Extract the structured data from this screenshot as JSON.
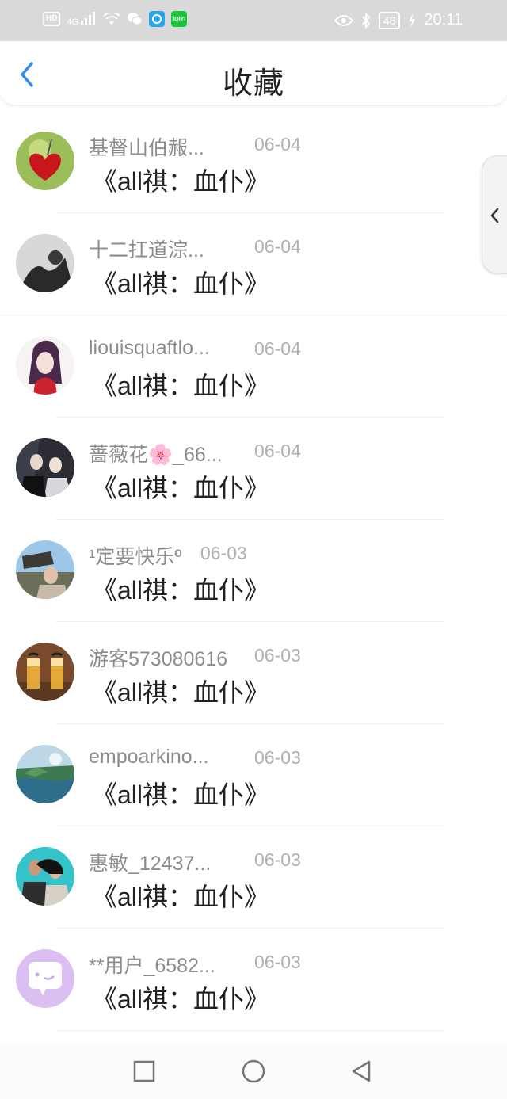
{
  "status_bar": {
    "badge": "HD",
    "signal": "4G",
    "app_iqiyi": "iQIYI",
    "battery": "48",
    "time": "20:11"
  },
  "header": {
    "title": "收藏"
  },
  "items": [
    {
      "user": "基督山伯赧...",
      "date": "06-04",
      "book": "《all祺：血仆》"
    },
    {
      "user": "十二扛道淙...",
      "date": "06-04",
      "book": "《all祺：血仆》"
    },
    {
      "user": "liouisquaftlo...",
      "date": "06-04",
      "book": "《all祺：血仆》"
    },
    {
      "user": "蔷薇花🌸_66...",
      "date": "06-04",
      "book": "《all祺：血仆》"
    },
    {
      "user": "¹定要快乐º",
      "date": "06-03",
      "book": "《all祺：血仆》"
    },
    {
      "user": "游客573080616",
      "date": "06-03",
      "book": "《all祺：血仆》"
    },
    {
      "user": "empoarkino...",
      "date": "06-03",
      "book": "《all祺：血仆》"
    },
    {
      "user": "惠敏_12437...",
      "date": "06-03",
      "book": "《all祺：血仆》"
    },
    {
      "user": "**用户_6582...",
      "date": "06-03",
      "book": "《all祺：血仆》"
    }
  ],
  "colors": {
    "accent": "#2f8fe8",
    "status_bar_bg": "#d9d9d9",
    "username": "#8c8c8c",
    "date": "#b0b0b0"
  }
}
